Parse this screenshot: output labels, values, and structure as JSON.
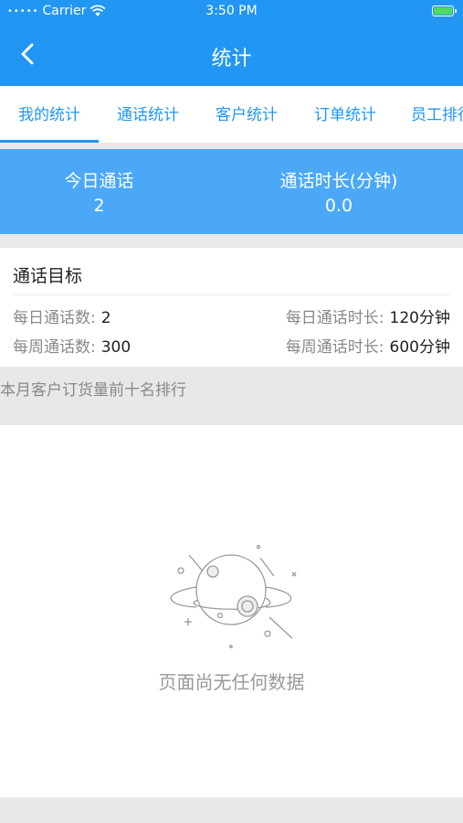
{
  "status_bar": {
    "carrier": "Carrier",
    "time": "3:50 PM"
  },
  "nav": {
    "title": "统计",
    "back_icon": "chevron-left-icon"
  },
  "tabs": [
    {
      "label": "我的统计",
      "active": true
    },
    {
      "label": "通话统计",
      "active": false
    },
    {
      "label": "客户统计",
      "active": false
    },
    {
      "label": "订单统计",
      "active": false
    },
    {
      "label": "员工排行",
      "active": false
    }
  ],
  "today": {
    "calls_label": "今日通话",
    "calls_value": "2",
    "duration_label": "通话时长(分钟)",
    "duration_value": "0.0"
  },
  "goal": {
    "title": "通话目标",
    "daily_calls_label": "每日通话数:",
    "daily_calls_value": "2",
    "daily_duration_label": "每日通话时长:",
    "daily_duration_value": "120分钟",
    "weekly_calls_label": "每周通话数:",
    "weekly_calls_value": "300",
    "weekly_duration_label": "每周通话时长:",
    "weekly_duration_value": "600分钟"
  },
  "ranking": {
    "title": "本月客户订货量前十名排行",
    "empty_icon": "planet-icon",
    "empty_text": "页面尚无任何数据"
  },
  "colors": {
    "primary": "#2196f3",
    "stats_bg": "#4ba8f7"
  }
}
